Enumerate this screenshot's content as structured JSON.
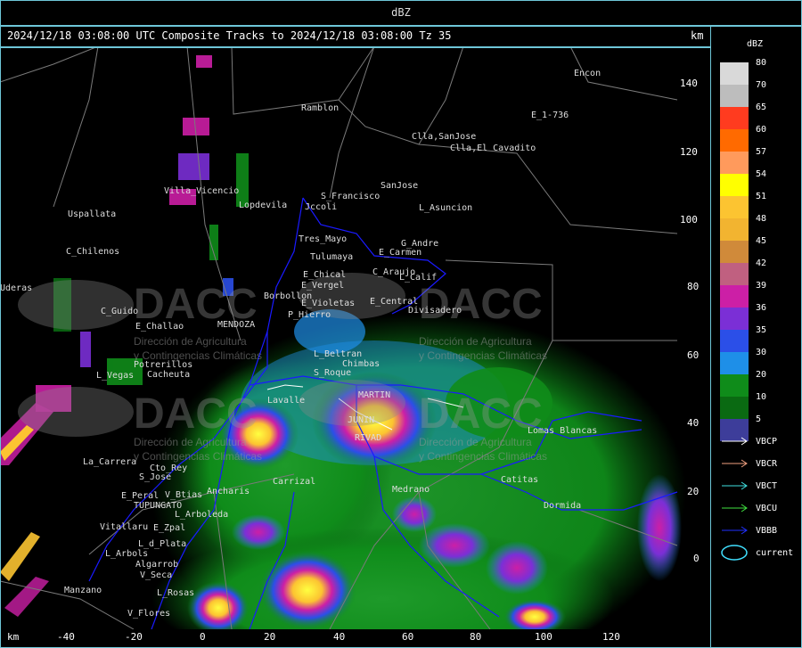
{
  "header": {
    "title": "dBZ",
    "subtitle": "2024/12/18 03:08:00 UTC Composite Tracks to 2024/12/18 03:08:00 Tz 35",
    "unit_top": "km",
    "unit_bottom": "km"
  },
  "x_ticks": [
    "-40",
    "-20",
    "0",
    "20",
    "40",
    "60",
    "80",
    "100",
    "120"
  ],
  "y_ticks": [
    "140",
    "120",
    "100",
    "80",
    "60",
    "40",
    "20",
    "0"
  ],
  "legend": {
    "title": "dBZ",
    "levels": [
      {
        "value": "80",
        "color": "#d9d9d9"
      },
      {
        "value": "70",
        "color": "#bdbdbd"
      },
      {
        "value": "65",
        "color": "#ff3b1f"
      },
      {
        "value": "60",
        "color": "#ff6a00"
      },
      {
        "value": "57",
        "color": "#ff9a5c"
      },
      {
        "value": "54",
        "color": "#ffff00"
      },
      {
        "value": "51",
        "color": "#fcc431"
      },
      {
        "value": "48",
        "color": "#f2b430"
      },
      {
        "value": "45",
        "color": "#d08a3a"
      },
      {
        "value": "42",
        "color": "#c06080"
      },
      {
        "value": "39",
        "color": "#cc1fa6"
      },
      {
        "value": "36",
        "color": "#7b2fd6"
      },
      {
        "value": "35",
        "color": "#2b4fe8"
      },
      {
        "value": "30",
        "color": "#1e8fe8"
      },
      {
        "value": "20",
        "color": "#0f8c1a"
      },
      {
        "value": "10",
        "color": "#0a6a12"
      },
      {
        "value": "5",
        "color": "#3d3d9a"
      }
    ],
    "tracks": [
      {
        "label": "VBCP",
        "color": "#ffffff"
      },
      {
        "label": "VBCR",
        "color": "#f0a080"
      },
      {
        "label": "VBCT",
        "color": "#40e0e0"
      },
      {
        "label": "VBCU",
        "color": "#40e040"
      },
      {
        "label": "VBBB",
        "color": "#2030ff"
      },
      {
        "label": "current",
        "color": "#40e0ff"
      }
    ]
  },
  "places": [
    {
      "name": "Ramblon"
    },
    {
      "name": "Clla,SanJose"
    },
    {
      "name": "Clla,El Cavadito"
    },
    {
      "name": "E_1-736"
    },
    {
      "name": "Encon"
    },
    {
      "name": "S_Francisco"
    },
    {
      "name": "Jccoli"
    },
    {
      "name": "SanJose"
    },
    {
      "name": "L_Asuncion"
    },
    {
      "name": "Uspallata"
    },
    {
      "name": "C_Chilenos"
    },
    {
      "name": "Tres_Mayo"
    },
    {
      "name": "G_Andre"
    },
    {
      "name": "Tulumaya"
    },
    {
      "name": "E_Carmen"
    },
    {
      "name": "E_Chical"
    },
    {
      "name": "C_Araujo"
    },
    {
      "name": "E_Vergel"
    },
    {
      "name": "L_Calif"
    },
    {
      "name": "Borbollon"
    },
    {
      "name": "E_Violetas"
    },
    {
      "name": "E_Central"
    },
    {
      "name": "Divisadero"
    },
    {
      "name": "C_Guido"
    },
    {
      "name": "P_Hierro"
    },
    {
      "name": "E_Challao"
    },
    {
      "name": "MENDOZA"
    },
    {
      "name": "Potrerillos"
    },
    {
      "name": "Cacheuta"
    },
    {
      "name": "L_Vegas"
    },
    {
      "name": "L_Beltran"
    },
    {
      "name": "Chimbas"
    },
    {
      "name": "S_Roque"
    },
    {
      "name": "MARTIN"
    },
    {
      "name": "JUNIN"
    },
    {
      "name": "RIVAD"
    },
    {
      "name": "Lomas Blancas"
    },
    {
      "name": "La_Carrera"
    },
    {
      "name": "Cto_Rey"
    },
    {
      "name": "S_Jose"
    },
    {
      "name": "E_Peral"
    },
    {
      "name": "V_Btias"
    },
    {
      "name": "Ancharis"
    },
    {
      "name": "Carrizal"
    },
    {
      "name": "TUPUNGATO"
    },
    {
      "name": "L_Arboleda"
    },
    {
      "name": "E_Zpal"
    },
    {
      "name": "Vitallaru"
    },
    {
      "name": "L_d_Plata"
    },
    {
      "name": "L_Arbols"
    },
    {
      "name": "Algarrob"
    },
    {
      "name": "V_Seca"
    },
    {
      "name": "Manzano"
    },
    {
      "name": "L_Rosas"
    },
    {
      "name": "V_Flores"
    },
    {
      "name": "Dormida"
    },
    {
      "name": "Catitas"
    },
    {
      "name": "Medrano"
    },
    {
      "name": "Uderas"
    },
    {
      "name": "Villa_Vicencio"
    },
    {
      "name": "Lavalle"
    },
    {
      "name": "Lopdevila"
    }
  ],
  "watermark": {
    "logo": "DACC",
    "line1": "Dirección de Agricultura",
    "line2": "y Contingencias Climáticas"
  }
}
